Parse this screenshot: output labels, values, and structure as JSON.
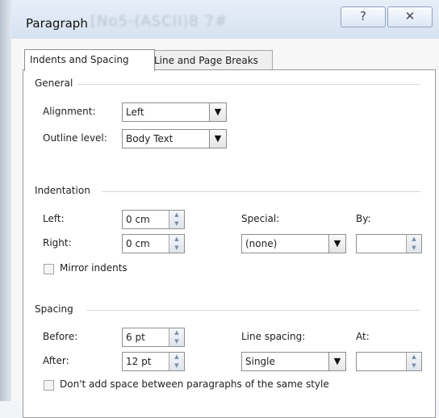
{
  "window": {
    "title": "Paragraph",
    "blurred_title": "[No5-(ASCII)8 7#",
    "help_icon": "question-mark",
    "close_icon": "close-x"
  },
  "tabs": [
    {
      "label": "Indents and Spacing",
      "active": true
    },
    {
      "label": "Line and Page Breaks",
      "active": false
    }
  ],
  "general": {
    "heading": "General",
    "alignment_label": "Alignment:",
    "alignment_value": "Left",
    "outline_label": "Outline level:",
    "outline_value": "Body Text"
  },
  "indentation": {
    "heading": "Indentation",
    "left_label": "Left:",
    "left_value": "0 cm",
    "right_label": "Right:",
    "right_value": "0 cm",
    "special_label": "Special:",
    "special_value": "(none)",
    "by_label": "By:",
    "by_value": "",
    "mirror_label": "Mirror indents",
    "mirror_checked": false
  },
  "spacing": {
    "heading": "Spacing",
    "before_label": "Before:",
    "before_value": "6 pt",
    "after_label": "After:",
    "after_value": "12 pt",
    "line_spacing_label": "Line spacing:",
    "line_spacing_value": "Single",
    "at_label": "At:",
    "at_value": "",
    "dont_add_space_label": "Don't add space between paragraphs of the same style",
    "dont_add_space_checked": false
  }
}
